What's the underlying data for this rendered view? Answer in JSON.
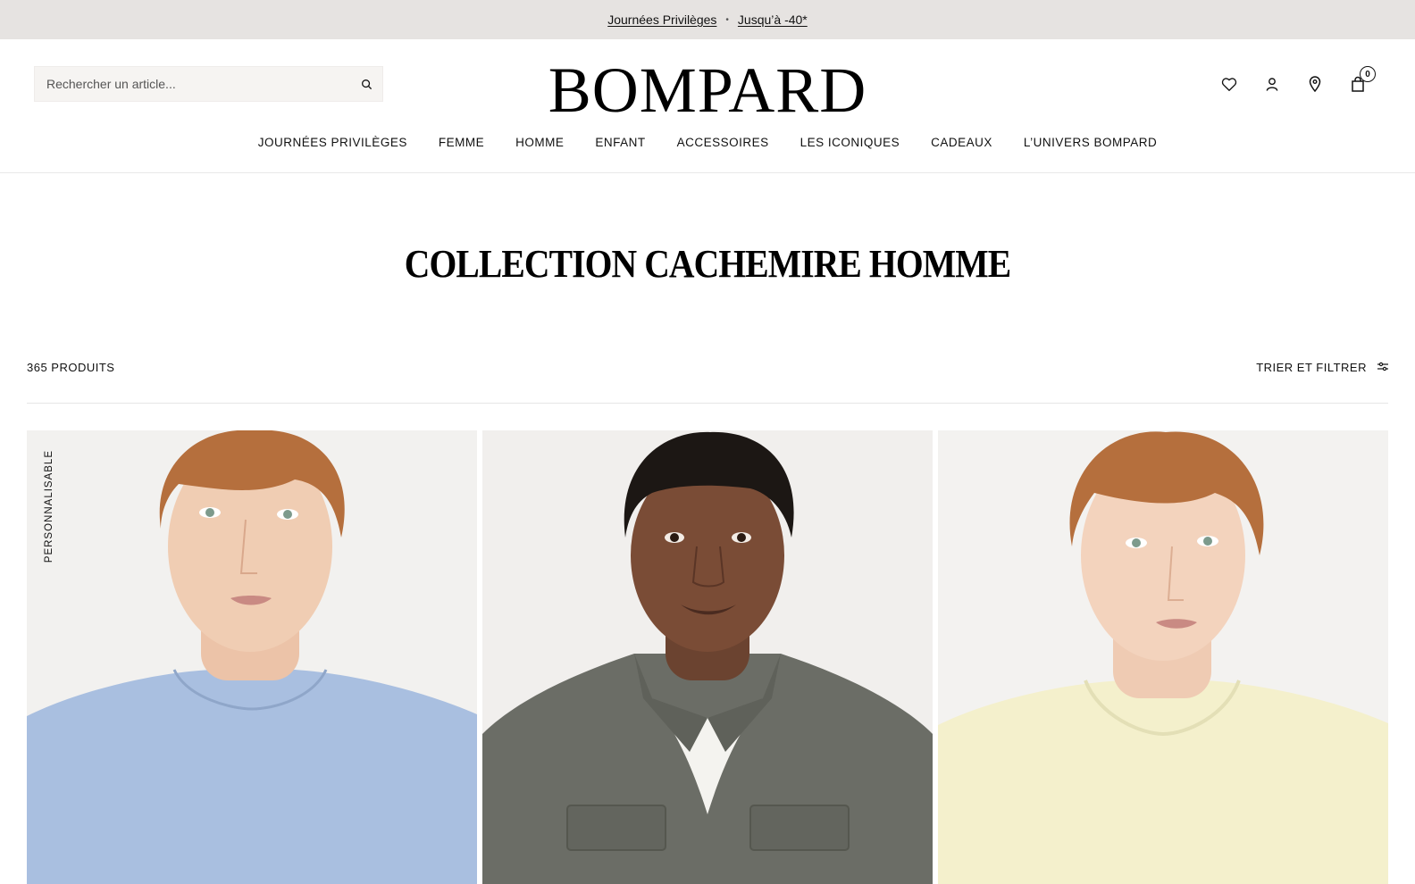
{
  "promo": {
    "link1": "Journées Privilèges",
    "link2": "Jusqu’à -40*",
    "bg": "#e6e3e1"
  },
  "header": {
    "logo": "BOMPARD",
    "search_placeholder": "Rechercher un article...",
    "icons": [
      "heart-icon",
      "user-icon",
      "location-pin-icon",
      "shopping-bag-icon",
      "search-icon"
    ],
    "cart_count": "0"
  },
  "nav": {
    "items": [
      "JOURNÉES PRIVILÈGES",
      "FEMME",
      "HOMME",
      "ENFANT",
      "ACCESSOIRES",
      "LES ICONIQUES",
      "CADEAUX",
      "L’UNIVERS BOMPARD"
    ]
  },
  "page": {
    "title": "COLLECTION CACHEMIRE HOMME",
    "product_count": "365 PRODUITS",
    "filter_label": "TRIER ET FILTRER"
  },
  "products": [
    {
      "badge": "PERSONNALISABLE",
      "sweater_color": "#a9bfe0",
      "background": "#f2f1ef"
    },
    {
      "badge": "",
      "sweater_color": "#6b6d66",
      "background": "#f1efed"
    },
    {
      "badge": "",
      "sweater_color": "#f4f0cc",
      "background": "#f3f2f0"
    }
  ]
}
